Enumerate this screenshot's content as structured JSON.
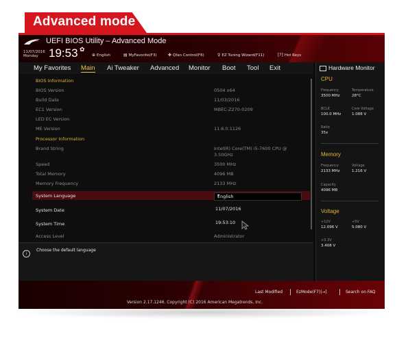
{
  "banner": "Advanced mode",
  "header": {
    "title": "UEFI BIOS Utility – Advanced Mode",
    "date": "11/07/2016",
    "day": "Monday",
    "time": "19:53",
    "items": [
      {
        "icon": "globe-icon",
        "label": "English"
      },
      {
        "icon": "favorite-icon",
        "label": "MyFavorite(F3)"
      },
      {
        "icon": "fan-icon",
        "label": "Qfan Control(F6)"
      },
      {
        "icon": "bulb-icon",
        "label": "EZ Tuning Wizard(F11)"
      },
      {
        "icon": "question-icon",
        "label": "Hot Keys"
      }
    ]
  },
  "menu": [
    "My Favorites",
    "Main",
    "Ai Tweaker",
    "Advanced",
    "Monitor",
    "Boot",
    "Tool",
    "Exit"
  ],
  "menu_active": "Main",
  "main": {
    "bios_info_header": "BIOS Information",
    "bios_rows": [
      {
        "label": "BIOS Version",
        "value": "0504 x64"
      },
      {
        "label": "Build Date",
        "value": "11/03/2016"
      },
      {
        "label": "EC1 Version",
        "value": "MBEC-Z270-0209"
      },
      {
        "label": "LED EC Version",
        "value": ""
      },
      {
        "label": "ME Version",
        "value": "11.6.0.1126"
      }
    ],
    "proc_info_header": "Processor Information",
    "brand_label": "Brand String",
    "brand_value_1": "Intel(R) Core(TM) i5-7600 CPU @",
    "brand_value_2": "3.50GHz",
    "proc_rows": [
      {
        "label": "Speed",
        "value": "3500 MHz"
      },
      {
        "label": "Total Memory",
        "value": "4096 MB"
      },
      {
        "label": "Memory Frequency",
        "value": "2133 MHz"
      }
    ],
    "system_language_label": "System Language",
    "system_language_value": "English",
    "system_date_label": "System Date",
    "system_date_value": "11/07/2016",
    "system_time_label": "System Time",
    "system_time_value": "19:53:10",
    "access_level_label": "Access Level",
    "access_level_value": "Administrator"
  },
  "help": {
    "text": "Choose the default language"
  },
  "hw": {
    "title": "Hardware Monitor",
    "cpu": {
      "header": "CPU",
      "freq_label": "Frequency",
      "freq_value": "3500 MHz",
      "temp_label": "Temperature",
      "temp_value": "28°C",
      "bclk_label": "BCLK",
      "bclk_value": "100.0 MHz",
      "corev_label": "Core Voltage",
      "corev_value": "1.088 V",
      "ratio_label": "Ratio",
      "ratio_value": "35x"
    },
    "memory": {
      "header": "Memory",
      "freq_label": "Frequency",
      "freq_value": "2133 MHz",
      "volt_label": "Voltage",
      "volt_value": "1.216 V",
      "cap_label": "Capacity",
      "cap_value": "4096 MB"
    },
    "voltage": {
      "header": "Voltage",
      "v12_label": "+12V",
      "v12_value": "12.096 V",
      "v5_label": "+5V",
      "v5_value": "5.080 V",
      "v33_label": "+3.3V",
      "v33_value": "3.408 V"
    }
  },
  "footer": {
    "last_modified": "Last Modified",
    "ezmode": "EzMode(F7)|→]",
    "search_faq": "Search on FAQ",
    "version": "Version 2.17.1246. Copyright (C) 2016 American Megatrends, Inc."
  },
  "colors": {
    "accent": "#d6161e",
    "highlight": "#e4b33b",
    "background": "#0b0b0b"
  }
}
